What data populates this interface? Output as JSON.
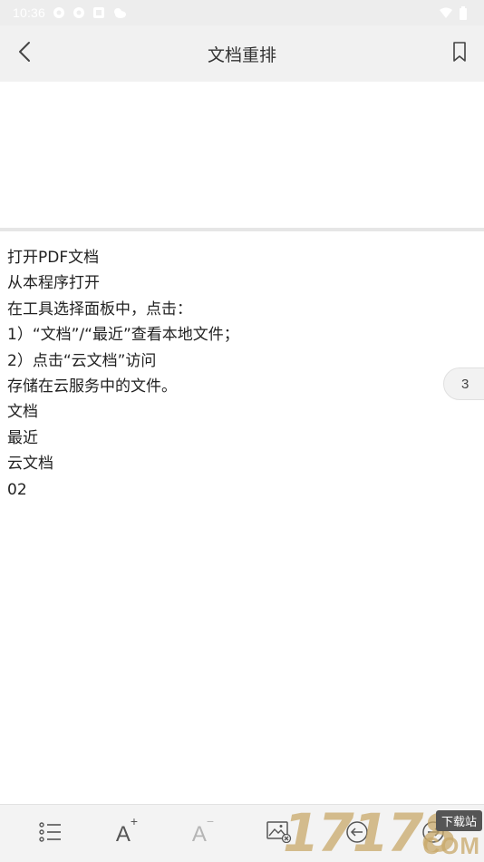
{
  "status_bar": {
    "time": "10:36",
    "left_icons": [
      "notification-icon",
      "notification-icon",
      "app-icon",
      "weather-icon"
    ],
    "right_icons": [
      "wifi-icon",
      "battery-icon"
    ]
  },
  "app_bar": {
    "title": "文档重排",
    "back_icon": "chevron-left-icon",
    "bookmark_icon": "bookmark-icon"
  },
  "document": {
    "lines": [
      "打开PDF文档",
      "从本程序打开",
      "在工具选择面板中，点击：",
      "1）“文档”/“最近”查看本地文件；",
      "2）点击“云文档”访问",
      "存储在云服务中的文件。",
      "文档",
      "最近",
      "云文档",
      "02"
    ]
  },
  "page_indicator": "3",
  "toolbar": {
    "items": [
      {
        "name": "outline-list",
        "icon": "list-icon"
      },
      {
        "name": "font-increase",
        "icon": "font-increase-icon",
        "glyph": "A",
        "sup": "+"
      },
      {
        "name": "font-decrease",
        "icon": "font-decrease-icon",
        "glyph": "A",
        "sup": "−"
      },
      {
        "name": "image-toggle",
        "icon": "image-off-icon"
      },
      {
        "name": "previous-page",
        "icon": "previous-arrow-icon"
      },
      {
        "name": "next-page",
        "icon": "next-arrow-icon"
      }
    ]
  },
  "watermark": {
    "number": "17178",
    "tag": "下载站",
    "suffix": "COM"
  },
  "colors": {
    "app_bar_bg": "#f1f1f1",
    "toolbar_bg": "#f3f3f3",
    "disabled_icon": "#b5b5b5",
    "icon": "#555555",
    "watermark": "#c9a96a"
  }
}
